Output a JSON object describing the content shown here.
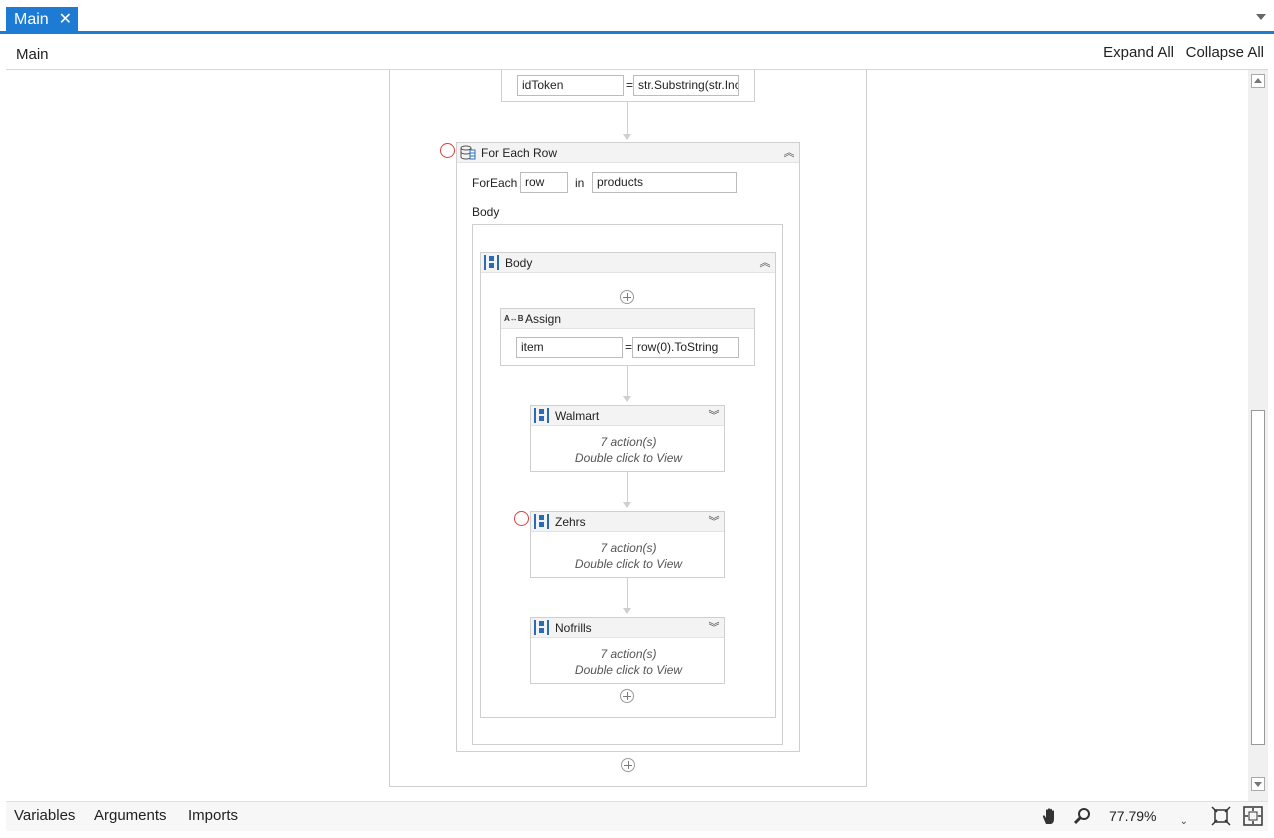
{
  "tabs": [
    {
      "label": "Main",
      "close": "✕"
    }
  ],
  "header": {
    "breadcrumb": "Main",
    "expand_all": "Expand All",
    "collapse_all": "Collapse All"
  },
  "assign_top": {
    "to": "idToken",
    "value": "str.Substring(str.Inc"
  },
  "foreach": {
    "title": "For Each Row",
    "keyword": "ForEach",
    "item": "row",
    "in_label": "in",
    "collection": "products",
    "body_label": "Body"
  },
  "body_seq": {
    "title": "Body"
  },
  "assign": {
    "title": "Assign",
    "icon_text": "A↔B",
    "to": "item",
    "value": "row(0).ToString"
  },
  "sequences": [
    {
      "title": "Walmart",
      "actions": "7 action(s)",
      "hint": "Double click to View"
    },
    {
      "title": "Zehrs",
      "actions": "7 action(s)",
      "hint": "Double click to View"
    },
    {
      "title": "Nofrills",
      "actions": "7 action(s)",
      "hint": "Double click to View"
    }
  ],
  "equals": "=",
  "bottom": {
    "variables": "Variables",
    "arguments": "Arguments",
    "imports": "Imports",
    "zoom": "77.79%"
  },
  "colors": {
    "accent": "#1e7bd4",
    "breakpoint": "#e23b3b"
  }
}
